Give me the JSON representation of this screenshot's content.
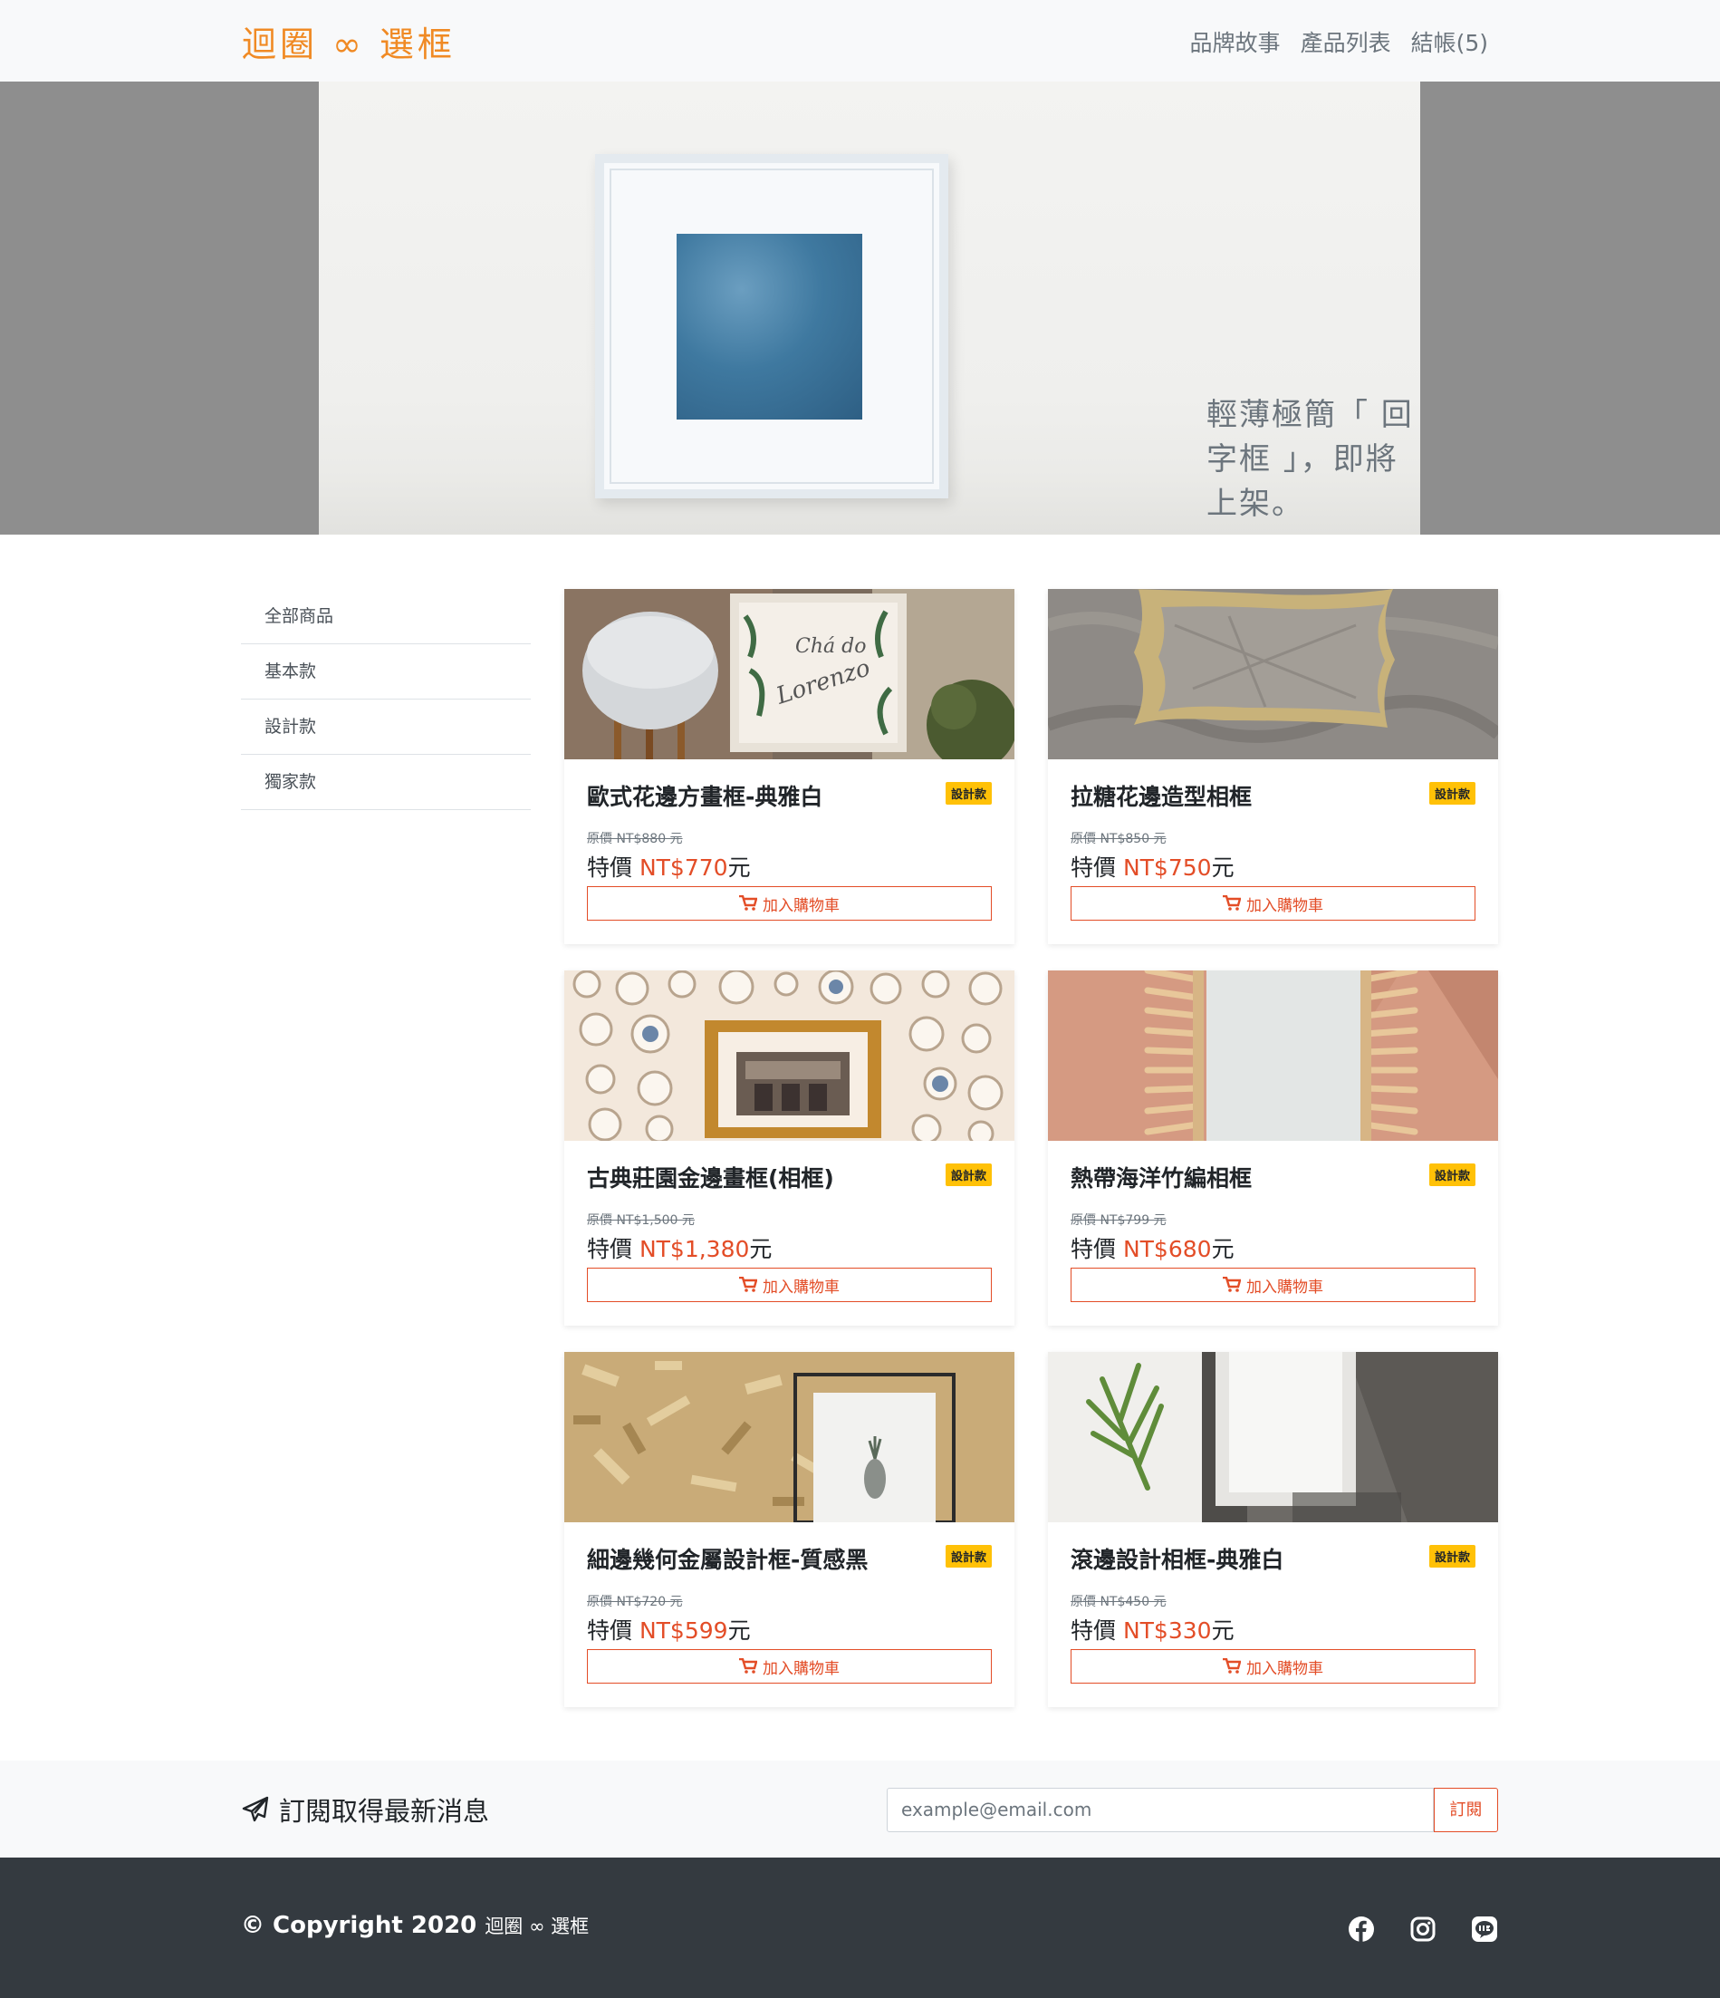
{
  "navbar": {
    "brand": "迴圈 ∞ 選框",
    "links": [
      "品牌故事",
      "產品列表",
      "結帳(5)"
    ]
  },
  "hero": {
    "caption": "輕薄極簡「 回字框 」，即將上架。"
  },
  "sidebar": {
    "items": [
      "全部商品",
      "基本款",
      "設計款",
      "獨家款"
    ]
  },
  "products": [
    {
      "title": "歐式花邊方畫框-典雅白",
      "badge": "設計款",
      "orig_price": "原價 NT$880 元",
      "price_prefix": "特價 ",
      "price": "NT$770",
      "price_suffix": "元",
      "button": "加入購物車",
      "image_text_1": "Chá do",
      "image_text_2": "Lorenzo"
    },
    {
      "title": "拉糖花邊造型相框",
      "badge": "設計款",
      "orig_price": "原價 NT$850 元",
      "price_prefix": "特價 ",
      "price": "NT$750",
      "price_suffix": "元",
      "button": "加入購物車"
    },
    {
      "title": "古典莊園金邊畫框(相框)",
      "badge": "設計款",
      "orig_price": "原價 NT$1,500 元",
      "price_prefix": "特價 ",
      "price": "NT$1,380",
      "price_suffix": "元",
      "button": "加入購物車"
    },
    {
      "title": "熱帶海洋竹編相框",
      "badge": "設計款",
      "orig_price": "原價 NT$799 元",
      "price_prefix": "特價 ",
      "price": "NT$680",
      "price_suffix": "元",
      "button": "加入購物車"
    },
    {
      "title": "細邊幾何金屬設計框-質感黑",
      "badge": "設計款",
      "orig_price": "原價 NT$720 元",
      "price_prefix": "特價 ",
      "price": "NT$599",
      "price_suffix": "元",
      "button": "加入購物車"
    },
    {
      "title": "滾邊設計相框-典雅白",
      "badge": "設計款",
      "orig_price": "原價 NT$450 元",
      "price_prefix": "特價 ",
      "price": "NT$330",
      "price_suffix": "元",
      "button": "加入購物車"
    }
  ],
  "subscribe": {
    "title": "訂閱取得最新消息",
    "placeholder": "example@email.com",
    "button": "訂閱"
  },
  "footer": {
    "copyright": "© Copyright 2020 ",
    "brand": "迴圈 ∞ 選框",
    "social": [
      "facebook-icon",
      "instagram-icon",
      "line-icon"
    ]
  },
  "colors": {
    "brand": "#f08a24",
    "accent": "#e34d27",
    "badge": "#ffc107",
    "footer": "#343a40"
  }
}
